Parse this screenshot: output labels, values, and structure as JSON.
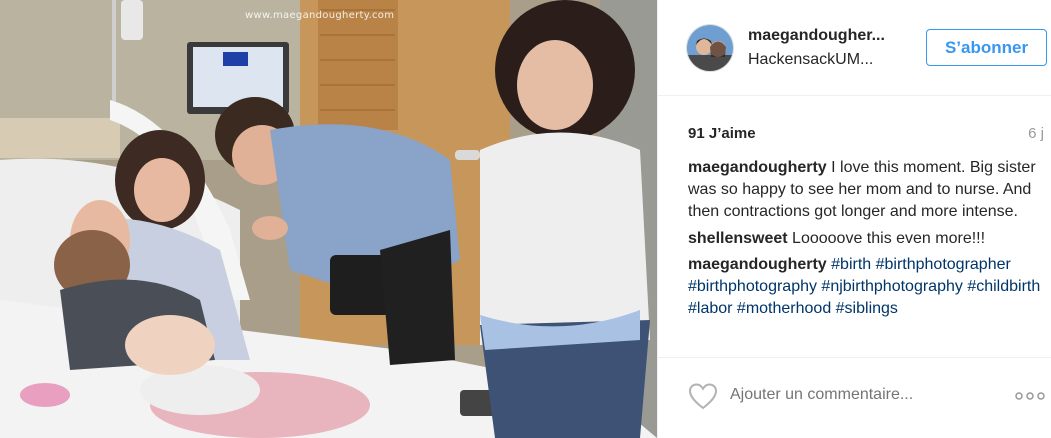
{
  "photo": {
    "watermark": "www.maegandougherty.com",
    "alt_icon": "hospital-birth-photo"
  },
  "header": {
    "username": "maegandougher...",
    "location": "HackensackUM...",
    "follow_label": "S’abonner"
  },
  "stats": {
    "likes": "91 J’aime",
    "age": "6 j"
  },
  "comments": [
    {
      "user": "maegandougherty",
      "text": " I love this moment. Big sister was so happy to see her mom and to nurse. And then contractions got longer and more intense."
    },
    {
      "user": "shellensweet",
      "text": " Looooove this even more!!!"
    },
    {
      "user": "maegandougherty",
      "tags": "#birth #birthphotographer #birthphotography #njbirthphotography #childbirth #labor #motherhood #siblings"
    }
  ],
  "footer": {
    "comment_placeholder": "Ajouter un commentaire...",
    "like_icon": "heart-icon",
    "more_icon": "more-options-icon"
  },
  "colors": {
    "accent": "#3897f0",
    "hashtag": "#003569",
    "muted": "#999999",
    "text": "#262626",
    "divider": "#efefef"
  }
}
